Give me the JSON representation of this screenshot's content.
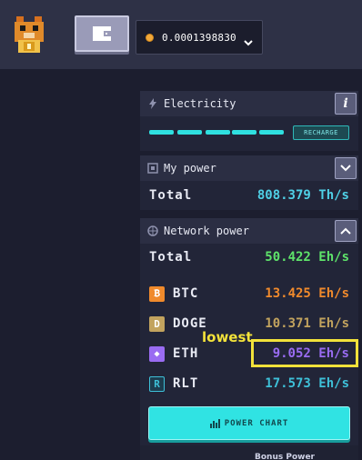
{
  "header": {
    "balance": "0.0001398830"
  },
  "electricity": {
    "title": "Electricity",
    "info_label": "i",
    "recharge_label": "RECHARGE",
    "level_segments": 5
  },
  "my_power": {
    "title": "My power",
    "total_label": "Total",
    "total_value": "808.379 Th/s"
  },
  "network_power": {
    "title": "Network power",
    "total_label": "Total",
    "total_value": "50.422 Eh/s",
    "coins": [
      {
        "symbol": "BTC",
        "icon_letter": "₿",
        "value": "13.425 Eh/s",
        "color": "#f08a2c"
      },
      {
        "symbol": "DOGE",
        "icon_letter": "D",
        "value": "10.371 Eh/s",
        "color": "#c2a35e"
      },
      {
        "symbol": "ETH",
        "icon_letter": "◆",
        "value": "9.052 Eh/s",
        "color": "#9a6cf2"
      },
      {
        "symbol": "RLT",
        "icon_letter": "R",
        "value": "17.573 Eh/s",
        "color": "#3ec0d8"
      }
    ],
    "chart_button": "POWER CHART"
  },
  "annotation": {
    "text": "lowest"
  },
  "footer": {
    "bonus_text": "Bonus Power"
  },
  "colors": {
    "accent_cyan": "#30e3e3",
    "total_green": "#5ee36a",
    "my_power_cyan": "#4fd0e6",
    "highlight_yellow": "#f2e23a"
  }
}
